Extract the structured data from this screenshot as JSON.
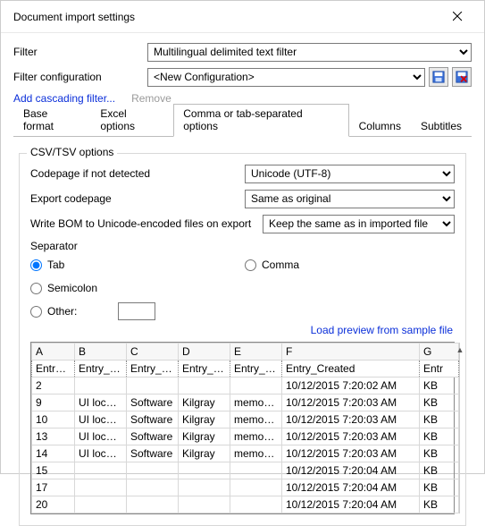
{
  "window": {
    "title": "Document import settings"
  },
  "filter": {
    "label": "Filter",
    "value": "Multilingual delimited text filter"
  },
  "filterConfig": {
    "label": "Filter configuration",
    "value": "<New Configuration>"
  },
  "links": {
    "addCascading": "Add cascading filter...",
    "remove": "Remove"
  },
  "icons": {
    "save": "save-icon",
    "delete": "delete-icon"
  },
  "tabs": [
    {
      "id": "base",
      "label": "Base format"
    },
    {
      "id": "excel",
      "label": "Excel options"
    },
    {
      "id": "csv",
      "label": "Comma or tab-separated options"
    },
    {
      "id": "columns",
      "label": "Columns"
    },
    {
      "id": "subtitles",
      "label": "Subtitles"
    }
  ],
  "activeTab": "csv",
  "group": {
    "legend": "CSV/TSV options",
    "codepage": {
      "label": "Codepage if not detected",
      "value": "Unicode (UTF-8)"
    },
    "exportCodepage": {
      "label": "Export codepage",
      "value": "Same as original"
    },
    "writeBom": {
      "label": "Write BOM to Unicode-encoded files on export",
      "value": "Keep the same as in imported file"
    },
    "separator": {
      "label": "Separator",
      "opts": {
        "tab": "Tab",
        "semicolon": "Semicolon",
        "other": "Other:",
        "comma": "Comma"
      },
      "selected": "tab",
      "otherValue": ""
    },
    "loadPreview": "Load preview from sample file"
  },
  "preview": {
    "columns": [
      "A",
      "B",
      "C",
      "D",
      "E",
      "F",
      "G"
    ],
    "headerRow": [
      "Entry_ID",
      "Entry_S...",
      "Entry_D...",
      "Entry_Cl...",
      "Entry_P...",
      "Entry_Created",
      "Entr"
    ],
    "rows": [
      [
        "2",
        "",
        "",
        "",
        "",
        "10/12/2015 7:20:02 AM",
        "KB"
      ],
      [
        "9",
        "UI locali...",
        "Software",
        "Kilgray",
        "memoQ ...",
        "10/12/2015 7:20:03 AM",
        "KB"
      ],
      [
        "10",
        "UI locali...",
        "Software",
        "Kilgray",
        "memoQ ...",
        "10/12/2015 7:20:03 AM",
        "KB"
      ],
      [
        "13",
        "UI locali...",
        "Software",
        "Kilgray",
        "memoQ ...",
        "10/12/2015 7:20:03 AM",
        "KB"
      ],
      [
        "14",
        "UI locali...",
        "Software",
        "Kilgray",
        "memoQ ...",
        "10/12/2015 7:20:03 AM",
        "KB"
      ],
      [
        "15",
        "",
        "",
        "",
        "",
        "10/12/2015 7:20:04 AM",
        "KB"
      ],
      [
        "17",
        "",
        "",
        "",
        "",
        "10/12/2015 7:20:04 AM",
        "KB"
      ],
      [
        "20",
        "",
        "",
        "",
        "",
        "10/12/2015 7:20:04 AM",
        "KB"
      ]
    ]
  }
}
